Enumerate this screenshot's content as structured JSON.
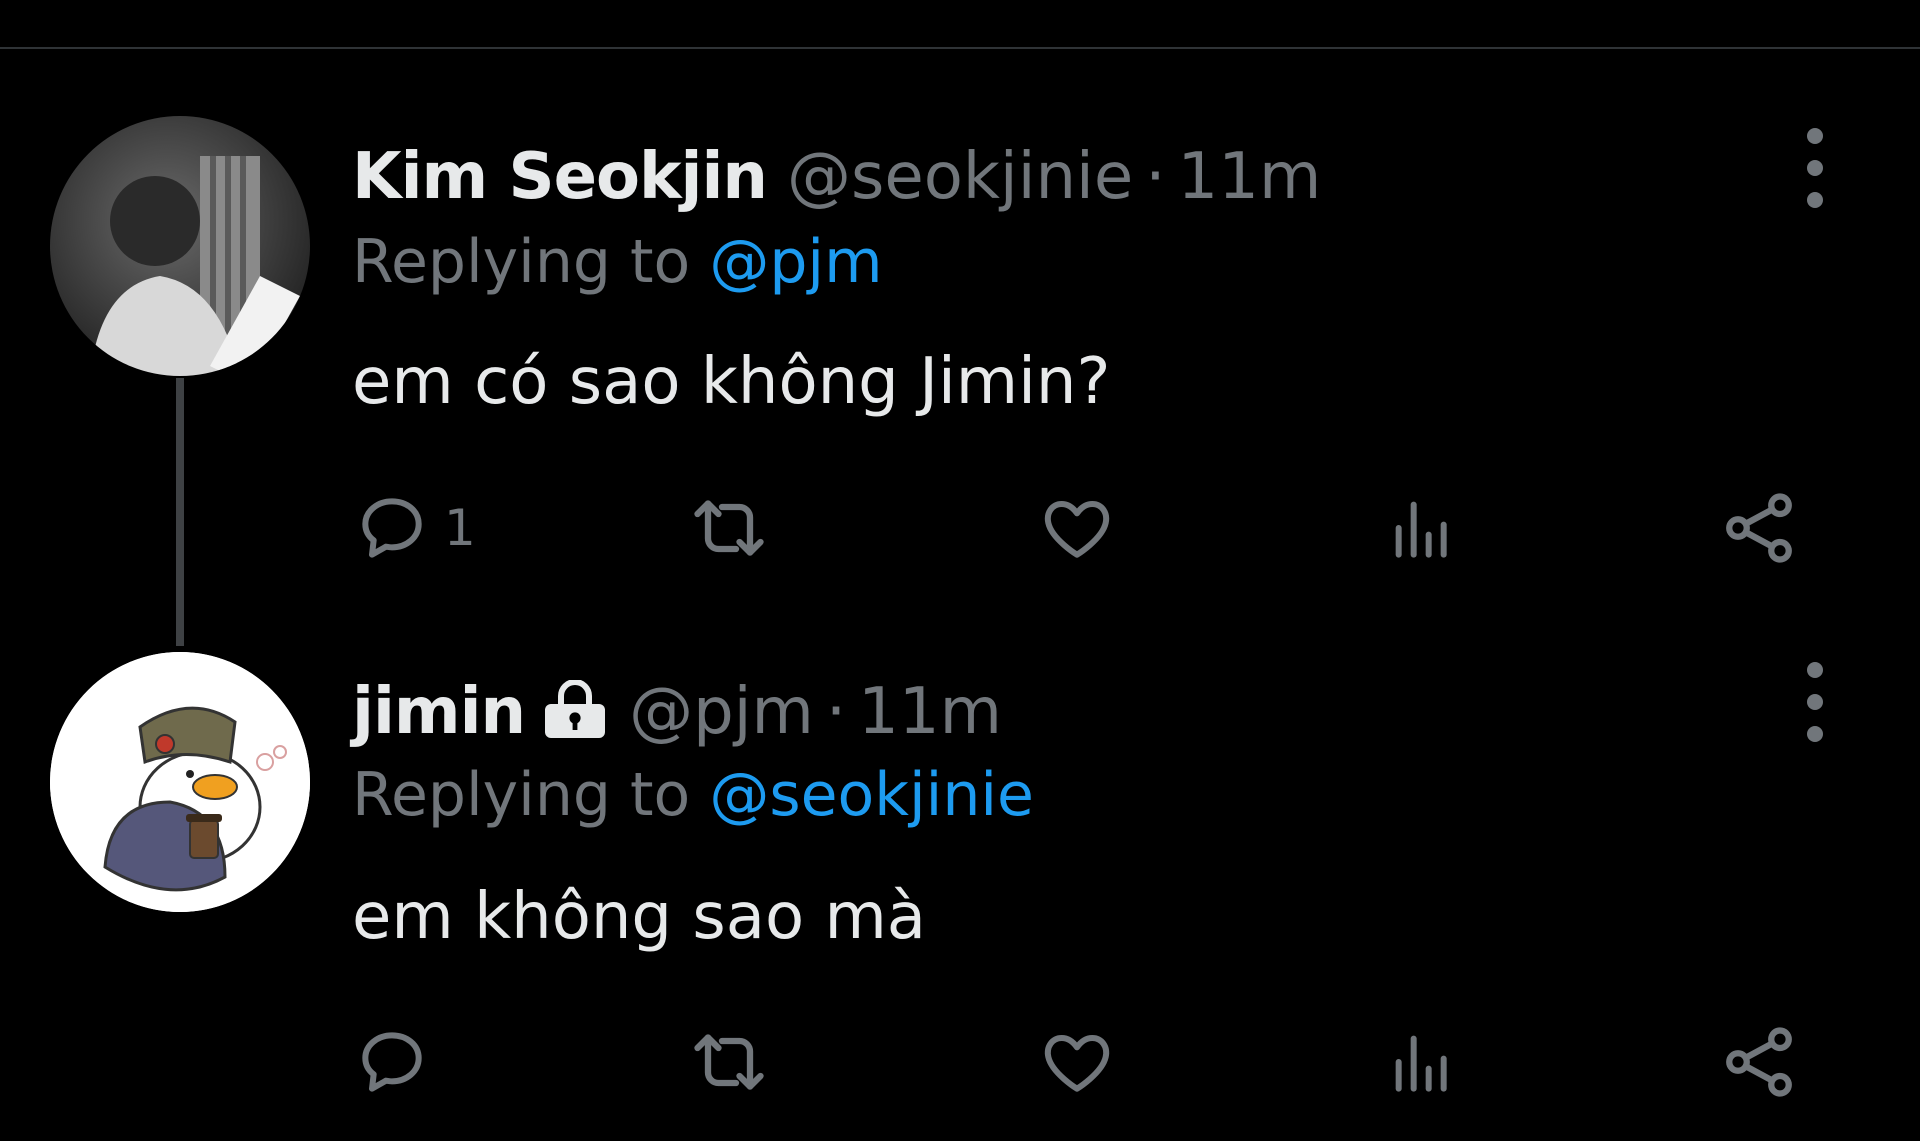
{
  "tweets": [
    {
      "name": "Kim Seokjin",
      "handle": "@seokjinie",
      "dot": "·",
      "time": "11m",
      "replying_prefix": "Replying to",
      "replying_to": "@pjm",
      "text": "em có sao không Jimin?",
      "reply_count": "1",
      "protected": false
    },
    {
      "name": "jimin",
      "handle": "@pjm",
      "dot": "·",
      "time": "11m",
      "replying_prefix": "Replying to",
      "replying_to": "@seokjinie",
      "text": "em không sao mà",
      "reply_count": "",
      "protected": true
    }
  ],
  "icons": {
    "reply": "reply-icon",
    "retweet": "retweet-icon",
    "like": "heart-icon",
    "views": "views-icon",
    "share": "share-icon",
    "more": "more-vertical-icon",
    "lock": "lock-icon"
  },
  "colors": {
    "background": "#000000",
    "text": "#e7e9ea",
    "secondary": "#71767b",
    "link": "#1d9bf0"
  }
}
